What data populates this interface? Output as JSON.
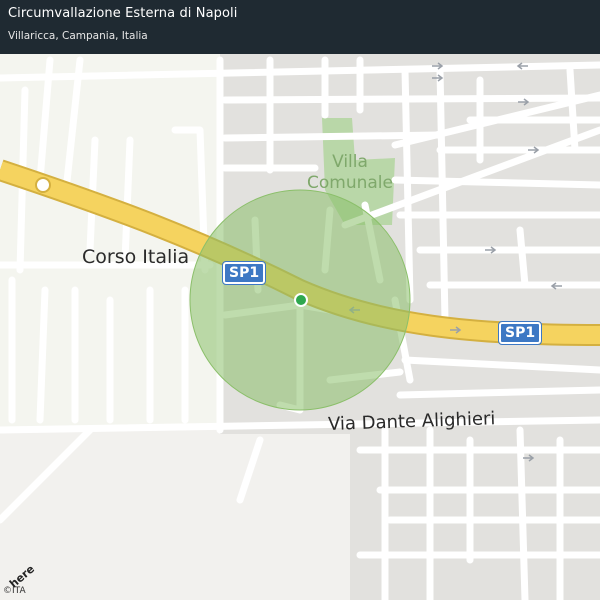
{
  "header": {
    "title": "Circumvallazione Esterna di Napoli",
    "subtitle": "Villaricca, Campania, Italia"
  },
  "labels": {
    "corso_italia": "Corso  Italia",
    "via_dante": "Via  Dante  Alighieri",
    "villa_comunale_line1": "Villa",
    "villa_comunale_line2": "Comunale"
  },
  "shields": {
    "sp1_left": "SP1",
    "sp1_right": "SP1"
  },
  "attribution": {
    "logo": "here",
    "copyright": "©ITA"
  },
  "colors": {
    "motorway": "#f5d35f",
    "accuracy_circle": "#8bbf6a",
    "park": "#b9d7a8",
    "location_dot": "#2fa84f",
    "header_bg": "#1f2a32"
  }
}
